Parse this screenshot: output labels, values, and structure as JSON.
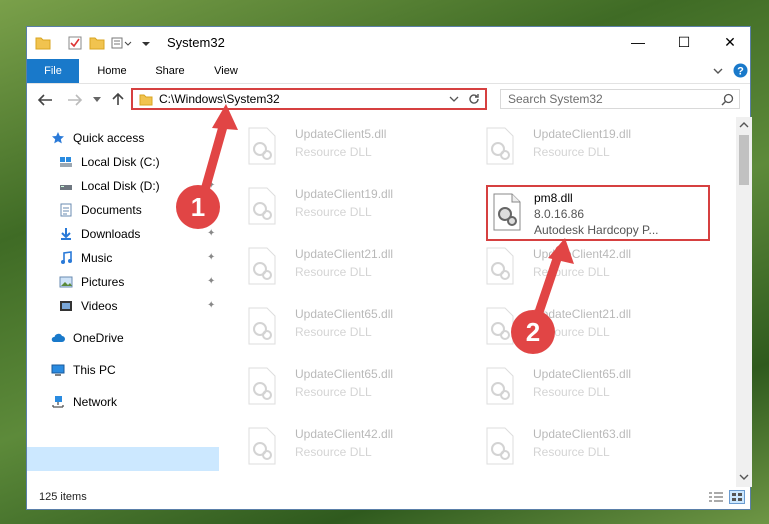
{
  "window": {
    "title": "System32"
  },
  "window_controls": {
    "minimize": "—",
    "maximize": "☐",
    "close": "✕"
  },
  "ribbon": {
    "tabs": [
      "File",
      "Home",
      "Share",
      "View"
    ]
  },
  "address": {
    "path": "C:\\Windows\\System32"
  },
  "search": {
    "placeholder": "Search System32"
  },
  "sidebar": {
    "items": [
      {
        "label": "Quick access",
        "icon": "star-icon"
      },
      {
        "label": "Local Disk (C:)",
        "icon": "drive-icon"
      },
      {
        "label": "Local Disk (D:)",
        "icon": "drive-icon"
      },
      {
        "label": "Documents",
        "icon": "documents-icon"
      },
      {
        "label": "Downloads",
        "icon": "downloads-icon"
      },
      {
        "label": "Music",
        "icon": "music-icon"
      },
      {
        "label": "Pictures",
        "icon": "pictures-icon"
      },
      {
        "label": "Videos",
        "icon": "videos-icon"
      },
      {
        "label": "OneDrive",
        "icon": "cloud-icon"
      },
      {
        "label": "This PC",
        "icon": "computer-icon"
      },
      {
        "label": "Network",
        "icon": "network-icon"
      }
    ]
  },
  "files": {
    "left": [
      {
        "name": "UpdateClient5.dll",
        "type": "Resource DLL"
      },
      {
        "name": "UpdateClient19.dll",
        "type": "Resource DLL"
      },
      {
        "name": "UpdateClient21.dll",
        "type": "Resource DLL"
      },
      {
        "name": "UpdateClient65.dll",
        "type": "Resource DLL"
      },
      {
        "name": "UpdateClient65.dll",
        "type": "Resource DLL"
      },
      {
        "name": "UpdateClient42.dll",
        "type": "Resource DLL"
      }
    ],
    "right": [
      {
        "name": "UpdateClient19.dll",
        "type": "Resource DLL"
      },
      {
        "name": "pm8.dll",
        "type": "8.0.16.86",
        "desc": "Autodesk Hardcopy P..."
      },
      {
        "name": "UpdateClient42.dll",
        "type": "Resource DLL"
      },
      {
        "name": "UpdateClient21.dll",
        "type": "Resource DLL"
      },
      {
        "name": "UpdateClient65.dll",
        "type": "Resource DLL"
      },
      {
        "name": "UpdateClient63.dll",
        "type": "Resource DLL"
      }
    ]
  },
  "status": {
    "count": "125 items"
  },
  "callouts": [
    "1",
    "2"
  ],
  "colors": {
    "accent": "#1979ca",
    "highlight": "#d64040",
    "selected": "#cce8ff"
  }
}
